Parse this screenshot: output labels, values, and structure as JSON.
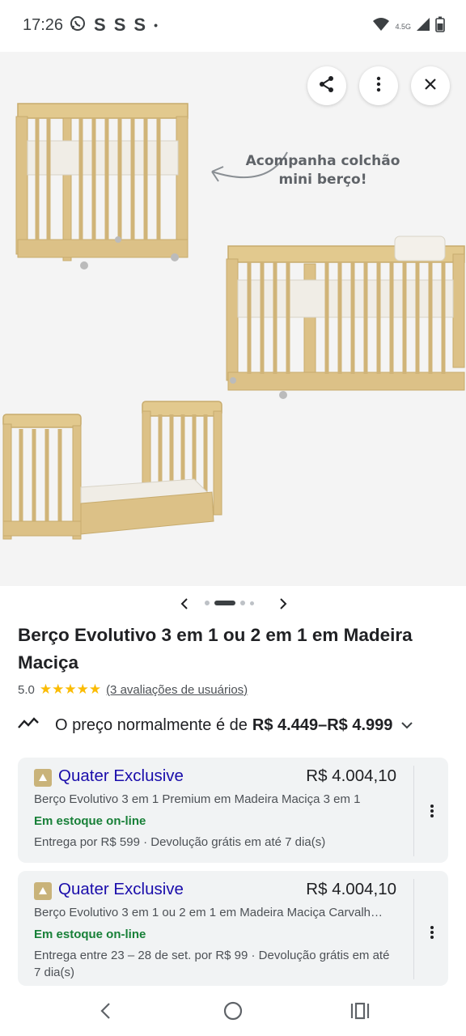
{
  "status_bar": {
    "time": "17:26",
    "left_icons": [
      "whatsapp-icon",
      "S",
      "S",
      "S",
      "•"
    ],
    "network_label": "4.5G"
  },
  "hero": {
    "caption": "Acompanha colchão mini berço!",
    "buttons": [
      "share-icon",
      "more-vert-icon",
      "close-icon"
    ]
  },
  "carousel": {
    "count": 4,
    "active_index": 1
  },
  "product": {
    "title": "Berço Evolutivo 3 em 1 ou 2 em 1 em Madeira Maciça",
    "rating_value": "5.0",
    "stars": "★★★★★",
    "reviews_link": "(3 avaliações de usuários)"
  },
  "price_insight": {
    "label": "O preço normalmente é de",
    "range": "R$ 4.449–R$ 4.999"
  },
  "offers": [
    {
      "merchant": "Quater Exclusive",
      "price": "R$ 4.004,10",
      "description": "Berço Evolutivo 3 em 1 Premium em Madeira Maciça 3 em 1",
      "stock": "Em estoque on-line",
      "delivery": "Entrega por R$ 599 · Devolução grátis em até 7 dia(s)"
    },
    {
      "merchant": "Quater Exclusive",
      "price": "R$ 4.004,10",
      "description": "Berço Evolutivo 3 em 1 ou 2 em 1 em Madeira Maciça Carvalh…",
      "stock": "Em estoque on-line",
      "delivery": "Entrega entre 23 – 28 de set. por R$ 99 · Devolução grátis em até 7 dia(s)"
    }
  ],
  "colors": {
    "link_blue": "#1a0dab",
    "in_stock_green": "#188038",
    "star_yellow": "#fbbc04",
    "card_bg": "#f1f3f4",
    "wood": "#e2c98e"
  },
  "nav_bar": [
    "back-icon",
    "home-icon",
    "recents-icon"
  ]
}
